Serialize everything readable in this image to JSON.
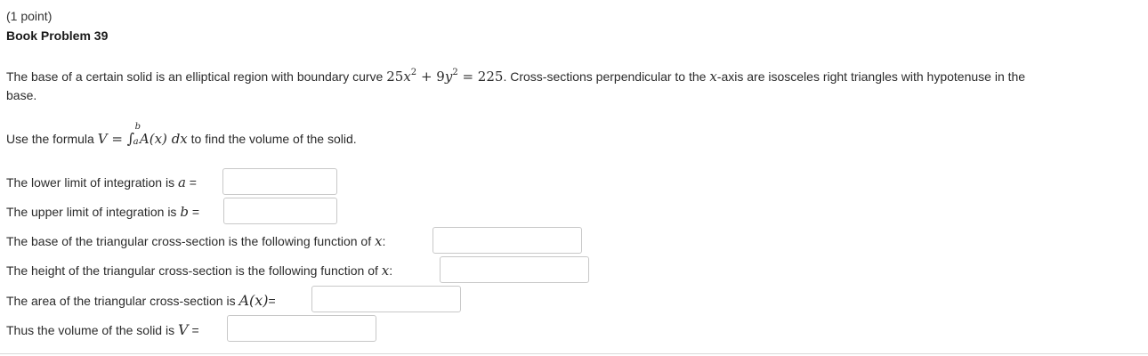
{
  "header": {
    "points": "(1 point)",
    "title": "Book Problem 39"
  },
  "problem": {
    "intro_start": "The base of a certain solid is an elliptical region with boundary curve ",
    "equation": {
      "a_coef": "25",
      "var_x": "x",
      "exp": "2",
      "plus": " + ",
      "b_coef": "9",
      "var_y": "y",
      "equals": " = ",
      "rhs": "225"
    },
    "intro_mid": ". Cross-sections perpendicular to the ",
    "axis_var": "x",
    "intro_end": "-axis are isosceles right triangles with hypotenuse in the",
    "intro_wrap": "base.",
    "formula_lead": "Use the formula ",
    "formula_V": "V",
    "formula_eq": " = ",
    "formula_int": "∫",
    "formula_upper": "b",
    "formula_lower": "a",
    "formula_A": "A",
    "formula_paren_x": "(x)",
    "formula_dx": " dx",
    "formula_tail": " to find the volume of the solid."
  },
  "questions": [
    {
      "text": "The lower limit of integration is ",
      "math": "a",
      "suffix": " =",
      "value": ""
    },
    {
      "text": "The upper limit of integration is ",
      "math": "b",
      "suffix": " =",
      "value": ""
    },
    {
      "text": "The base of the triangular cross-section is the following function of ",
      "math": "x",
      "suffix": ":",
      "value": ""
    },
    {
      "text": "The height of the triangular cross-section is the following function of ",
      "math": "x",
      "suffix": ":",
      "value": ""
    },
    {
      "text": "The area of the triangular cross-section is ",
      "math": "A(x)",
      "suffix": "=",
      "value": ""
    },
    {
      "text": "Thus the volume of the solid is ",
      "math": "V",
      "suffix": " =",
      "value": ""
    }
  ]
}
